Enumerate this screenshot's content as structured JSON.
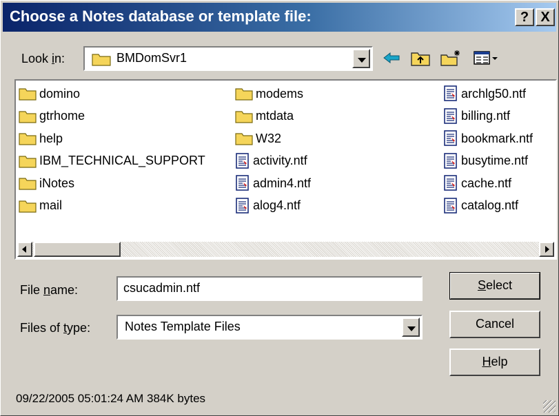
{
  "dialog": {
    "title": "Choose a Notes database or template file:",
    "help_glyph": "?",
    "close_glyph": "X"
  },
  "look_in": {
    "label_before": "Look ",
    "label_mnemonic": "i",
    "label_after": "n:",
    "value": "BMDomSvr1"
  },
  "toolbar": {
    "icons": [
      "back-arrow-icon",
      "up-folder-icon",
      "new-folder-icon",
      "view-menu-icon"
    ]
  },
  "files": {
    "col1": [
      "domino",
      "gtrhome",
      "help",
      "IBM_TECHNICAL_SUPPORT",
      "iNotes",
      "mail"
    ],
    "col2": [
      {
        "name": "modems",
        "type": "folder"
      },
      {
        "name": "mtdata",
        "type": "folder"
      },
      {
        "name": "W32",
        "type": "folder"
      },
      {
        "name": "activity.ntf",
        "type": "file"
      },
      {
        "name": "admin4.ntf",
        "type": "file"
      },
      {
        "name": "alog4.ntf",
        "type": "file"
      }
    ],
    "col3": [
      "archlg50.ntf",
      "billing.ntf",
      "bookmark.ntf",
      "busytime.ntf",
      "cache.ntf",
      "catalog.ntf"
    ]
  },
  "file_name": {
    "label_before": "File ",
    "label_mnemonic": "n",
    "label_after": "ame:",
    "value": "csucadmin.ntf"
  },
  "file_type": {
    "label_before": "Files of ",
    "label_mnemonic": "t",
    "label_after": "ype:",
    "value": "Notes Template Files"
  },
  "buttons": {
    "select_mnemonic": "S",
    "select_rest": "elect",
    "cancel": "Cancel",
    "help_mnemonic": "H",
    "help_rest": "elp"
  },
  "status": "09/22/2005 05:01:24 AM 384K bytes",
  "colors": {
    "titlebar_start": "#0a246a",
    "titlebar_end": "#a6caf0",
    "dialog_face": "#d4d0c8",
    "folder_yellow": "#f5d55a",
    "back_arrow": "#1aa5c8"
  }
}
